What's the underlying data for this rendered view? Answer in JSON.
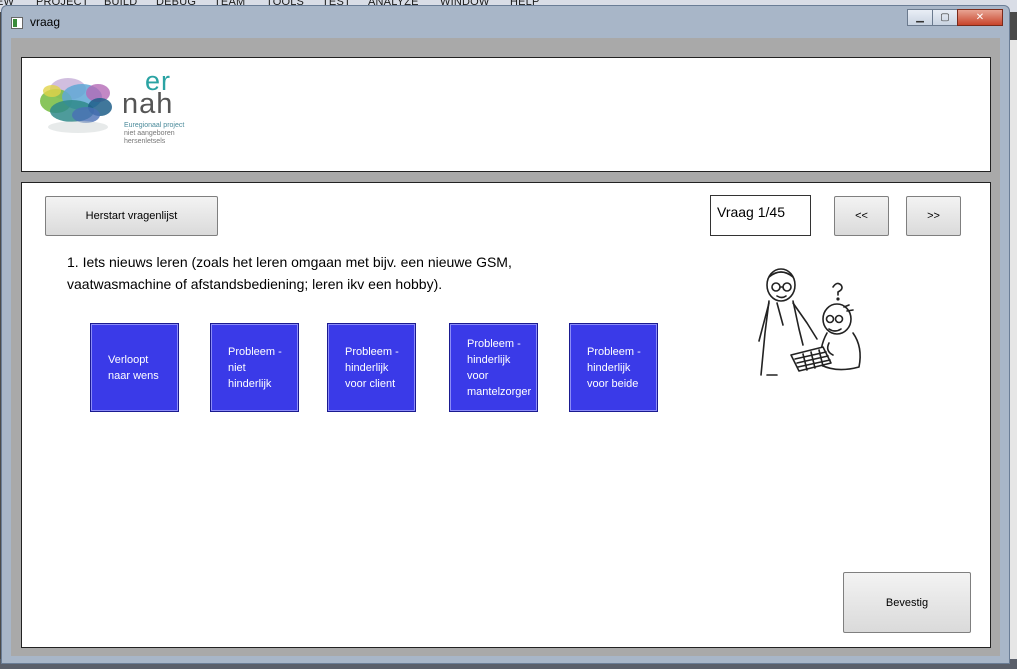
{
  "background_ide": {
    "menu_items": [
      "EW",
      "PROJECT",
      "BUILD",
      "DEBUG",
      "TEAM",
      "TOOLS",
      "TEST",
      "ANALYZE",
      "WINDOW",
      "HELP"
    ]
  },
  "window": {
    "title": "vraag",
    "minimize_label": "▁",
    "maximize_label": "▢",
    "close_label": "✕"
  },
  "logo": {
    "er": "er",
    "nah": "nah",
    "subtitle_lines": [
      "Euregionaal project",
      "niet aangeboren",
      "hersenletsels"
    ]
  },
  "toolbar": {
    "restart_label": "Herstart vragenlijst",
    "counter": "Vraag 1/45",
    "prev_label": "<<",
    "next_label": ">>"
  },
  "question": {
    "line1": "1. Iets nieuws leren (zoals het leren omgaan met bijv. een nieuwe GSM,",
    "line2": "vaatwasmachine of afstandsbediening; leren ikv een hobby)."
  },
  "answers": [
    {
      "lines": [
        "Verloopt",
        "naar wens"
      ]
    },
    {
      "lines": [
        "Probleem -",
        "niet",
        "hinderlijk"
      ]
    },
    {
      "lines": [
        "Probleem -",
        "hinderlijk",
        "voor client"
      ]
    },
    {
      "lines": [
        "Probleem -",
        "hinderlijk",
        "voor",
        "mantelzorger"
      ]
    },
    {
      "lines": [
        "Probleem -",
        "hinderlijk",
        "voor beide"
      ]
    }
  ],
  "confirm_label": "Bevestig",
  "colors": {
    "answer_bg": "#3a3ae8",
    "window_frame": "#a8b6c8",
    "client_bg": "#a9a9a9"
  }
}
